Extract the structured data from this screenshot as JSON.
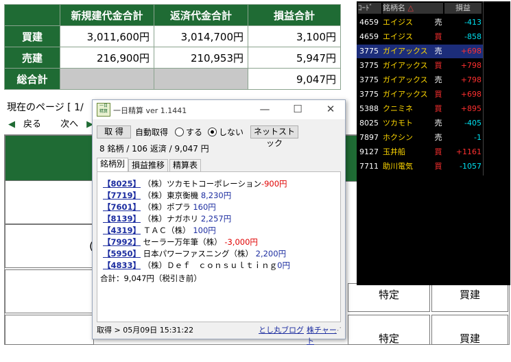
{
  "summary": {
    "headers": [
      "新規建代金合計",
      "返済代金合計",
      "損益合計"
    ],
    "rows": [
      {
        "label": "買建",
        "values": [
          "3,011,600円",
          "3,014,700円",
          "3,100円"
        ]
      },
      {
        "label": "売建",
        "values": [
          "216,900円",
          "210,953円",
          "5,947円"
        ]
      },
      {
        "label": "総合計",
        "values": [
          "",
          "",
          "9,047円"
        ]
      }
    ]
  },
  "page_nav": {
    "current_page": "現在のページ [ 1/",
    "back": "戻る",
    "next": "次へ",
    "fragment": "|(",
    "cut_text": "("
  },
  "bg_grid": {
    "cells": [
      "特定",
      "買建",
      "特定",
      "買建"
    ]
  },
  "stock_list": {
    "headers": [
      "ｺｰﾄﾞ",
      "銘柄名",
      "損益"
    ],
    "sort_icon": "△",
    "rows": [
      {
        "code": "4659",
        "name": "エイジス",
        "side": "売",
        "pnl": "-413"
      },
      {
        "code": "4659",
        "name": "エイジス",
        "side": "買",
        "pnl": "-858"
      },
      {
        "code": "3775",
        "name": "ガイアックス",
        "side": "売",
        "pnl": "+698"
      },
      {
        "code": "3775",
        "name": "ガイアックス",
        "side": "買",
        "pnl": "+798"
      },
      {
        "code": "3775",
        "name": "ガイアックス",
        "side": "売",
        "pnl": "+798"
      },
      {
        "code": "3775",
        "name": "ガイアックス",
        "side": "買",
        "pnl": "+698"
      },
      {
        "code": "5388",
        "name": "クニミネ",
        "side": "買",
        "pnl": "+895"
      },
      {
        "code": "8025",
        "name": "ツカモト",
        "side": "売",
        "pnl": "-405"
      },
      {
        "code": "7897",
        "name": "ホクシン",
        "side": "売",
        "pnl": "-1"
      },
      {
        "code": "9127",
        "name": "玉井船",
        "side": "買",
        "pnl": "+1161"
      },
      {
        "code": "7711",
        "name": "助川電気",
        "side": "買",
        "pnl": "-1057"
      }
    ]
  },
  "dialog": {
    "icon_text": "一日\n精算",
    "title": "一日精算 ver 1.1441",
    "btn_get": "取 得",
    "auto_label": "自動取得",
    "radio_on": "する",
    "radio_off": "しない",
    "btn_net": "ネットストック",
    "summary_line": "8 銘柄 / 106 返済 / 9,047 円",
    "tabs": [
      "銘柄別",
      "損益推移",
      "精算表"
    ],
    "items": [
      {
        "code": "【8025】",
        "name": "（株）ツカモトコーポレーション",
        "pnl": "-900円"
      },
      {
        "code": "【7719】",
        "name": "（株）東京衡機",
        "pnl": "8,230円"
      },
      {
        "code": "【7601】",
        "name": "（株）ポプラ",
        "pnl": "160円"
      },
      {
        "code": "【8139】",
        "name": "（株）ナガホリ",
        "pnl": "2,257円"
      },
      {
        "code": "【4319】",
        "name": "ＴＡＣ（株）",
        "pnl": "100円"
      },
      {
        "code": "【7992】",
        "name": "セーラー万年筆（株）",
        "pnl": "-3,000円"
      },
      {
        "code": "【5950】",
        "name": "日本パワーファスニング（株）",
        "pnl": "2,200円"
      },
      {
        "code": "【4833】",
        "name": "（株）Ｄｅｆ　ｃｏｎｓｕｌｔｉｎｇ",
        "pnl": "0円"
      }
    ],
    "total": "合計：9,047円（税引き前）",
    "status": "取得 > 05月09日 15:31:22",
    "link_blog": "とし丸ブログ",
    "link_chart": "株チャート"
  }
}
